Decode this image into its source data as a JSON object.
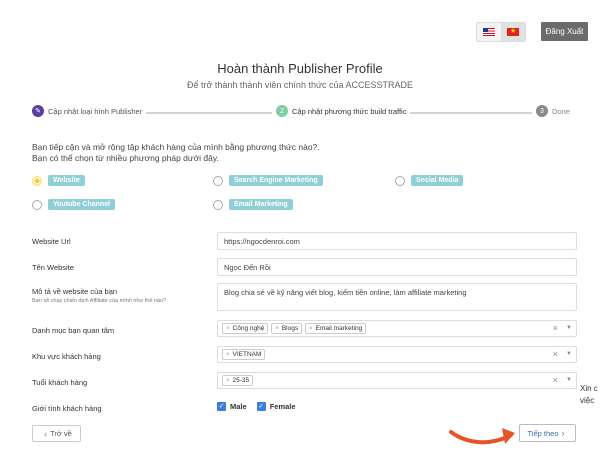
{
  "header": {
    "logout_label": "Đăng Xuất",
    "languages": [
      {
        "code": "en",
        "icon": "us-flag-icon"
      },
      {
        "code": "vi",
        "icon": "vn-flag-icon",
        "active": true
      }
    ]
  },
  "page": {
    "title": "Hoàn thành Publisher Profile",
    "subtitle": "Để trở thành thành viên chính thức của ACCESSTRADE"
  },
  "steps": [
    {
      "marker": "✎",
      "label": "Cập nhật loại hình Publisher",
      "status": "done",
      "color": "#5b3fa0"
    },
    {
      "marker": "2",
      "label": "Cập nhật phương thức build traffic",
      "status": "current",
      "color": "#7ccf9e"
    },
    {
      "marker": "3",
      "label": "Done",
      "status": "pending",
      "color": "#8a8a8a"
    }
  ],
  "question": {
    "line1": "Bạn tiếp cận và mở rộng tập khách hàng của mình bằng phương thức nào?.",
    "line2": "Bạn có thể chọn từ nhiều phương pháp dưới đây."
  },
  "methods": [
    {
      "label": "Website",
      "checked": true
    },
    {
      "label": "Search Engine Marketing",
      "checked": false
    },
    {
      "label": "Social Media",
      "checked": false
    },
    {
      "label": "Youtube Channel",
      "checked": false
    },
    {
      "label": "Email Marketing",
      "checked": false
    }
  ],
  "form": {
    "website_url": {
      "label": "Website Url",
      "value": "https://ngocdenroi.com"
    },
    "website_name": {
      "label": "Tên Website",
      "value": "Ngọc Đến Rồi"
    },
    "description": {
      "label": "Mô tả về website của bạn",
      "hint": "Bạn sẽ chạy chiến dịch Affiliate của mình như thế nào?",
      "value": "Blog chia sẻ về kỹ năng viết blog, kiếm tiền online, làm affiliate marketing"
    },
    "categories": {
      "label": "Danh mục bạn quan tâm",
      "tags": [
        "Công nghệ",
        "Blogs",
        "Email marketing"
      ]
    },
    "region": {
      "label": "Khu vực khách hàng",
      "tags": [
        "VIETNAM"
      ]
    },
    "age": {
      "label": "Tuổi khách hàng",
      "tags": [
        "25-35"
      ]
    },
    "gender": {
      "label": "Giới tính khách hàng",
      "options": [
        "Male",
        "Female"
      ]
    }
  },
  "buttons": {
    "back_label": "Trở về",
    "next_label": "Tiếp theo"
  },
  "tooltip": {
    "line1": "Xin c",
    "line2": "việc"
  },
  "colors": {
    "accent_pill": "#8fd0d8",
    "checkbox": "#3b7ddd",
    "arrow": "#e8542a"
  }
}
